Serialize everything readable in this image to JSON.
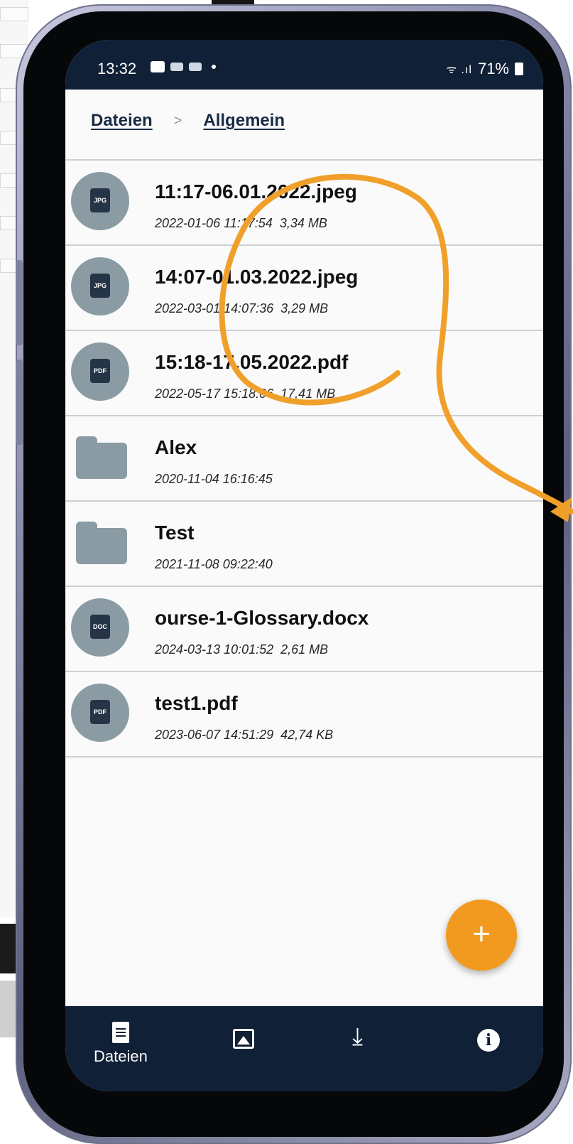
{
  "status_bar": {
    "time": "13:32",
    "battery": "71%"
  },
  "breadcrumb": {
    "items": [
      "Dateien",
      "Allgemein"
    ],
    "separator": ">"
  },
  "files": [
    {
      "name": "11:17-06.01.2022.jpeg",
      "date": "2022-01-06 11:17:54",
      "size": "3,34 MB",
      "type": "JPG",
      "icon": "jpg-file-icon"
    },
    {
      "name": "14:07-01.03.2022.jpeg",
      "date": "2022-03-01 14:07:36",
      "size": "3,29 MB",
      "type": "JPG",
      "icon": "jpg-file-icon"
    },
    {
      "name": "15:18-17.05.2022.pdf",
      "date": "2022-05-17 15:18:06",
      "size": "17,41 MB",
      "type": "PDF",
      "icon": "pdf-file-icon"
    },
    {
      "name": "Alex",
      "date": "2020-11-04 16:16:45",
      "size": "",
      "type": "",
      "icon": "folder-icon"
    },
    {
      "name": "Test",
      "date": "2021-11-08 09:22:40",
      "size": "",
      "type": "",
      "icon": "folder-icon"
    },
    {
      "name": "ourse-1-Glossary.docx",
      "date": "2024-03-13 10:01:52",
      "size": "2,61 MB",
      "type": "DOC",
      "icon": "doc-file-icon"
    },
    {
      "name": "test1.pdf",
      "date": "2023-06-07 14:51:29",
      "size": "42,74 KB",
      "type": "PDF",
      "icon": "pdf-file-icon"
    }
  ],
  "fab": {
    "label": "+"
  },
  "bottom_nav": {
    "items": [
      {
        "label": "Dateien",
        "icon": "document-icon"
      },
      {
        "label": "",
        "icon": "gallery-icon"
      },
      {
        "label": "",
        "icon": "download-icon"
      },
      {
        "label": "",
        "icon": "info-icon"
      }
    ]
  },
  "colors": {
    "bar_background": "#102036",
    "accent": "#f29a1f",
    "icon_grey": "#8a9ba4",
    "annotation": "#f0a02a"
  }
}
